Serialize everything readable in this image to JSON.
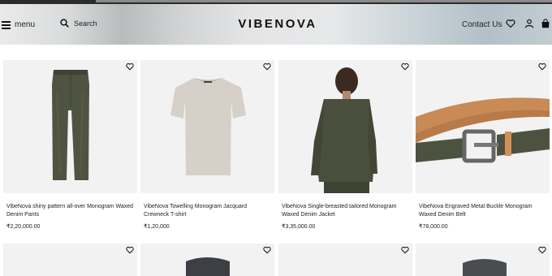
{
  "header": {
    "menu_label": "menu",
    "search_label": "Search",
    "brand": "VIBENOVA",
    "contact_label": "Contact Us"
  },
  "icons": {
    "menu": "hamburger-icon",
    "search": "search-icon",
    "wishlist": "heart-icon",
    "account": "user-icon",
    "bag": "shopping-bag-icon",
    "favorite": "heart-icon"
  },
  "products": [
    {
      "title": "VibeNova shiny pattern all-over Monogram Waxed Denim Pants",
      "price": "₹2,20,000.00"
    },
    {
      "title": "VibeNova Towelling Monogram Jacquard Crewneck T-shirt",
      "price": "₹1,20,000"
    },
    {
      "title": "VibeNova Single-breasted tailored Monogram Waxed Denim Jacket",
      "price": "₹3,35,000.00"
    },
    {
      "title": "VibeNova Engraved Metal Buckle Monogram Waxed Denim Belt",
      "price": "₹78,000.00"
    }
  ],
  "colors": {
    "denim_green": "#4d5240",
    "tshirt_beige": "#d9d3cc",
    "belt_tan": "#c98a55"
  }
}
